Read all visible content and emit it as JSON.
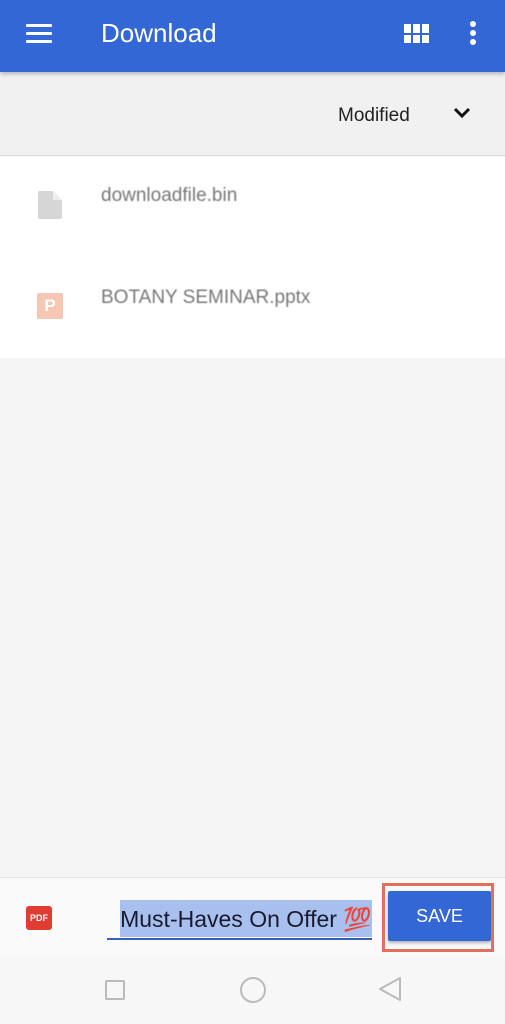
{
  "appbar": {
    "title": "Download",
    "menu_icon": "hamburger-menu-icon",
    "grid_icon": "grid-view-icon",
    "more_icon": "more-vert-icon",
    "color": "#3367d6"
  },
  "sort": {
    "label": "Modified",
    "icon": "chevron-down-icon"
  },
  "files": [
    {
      "name": "downloadfile.bin",
      "icon": "generic-file-icon"
    },
    {
      "name": "BOTANY SEMINAR.pptx",
      "icon": "powerpoint-file-icon",
      "icon_letter": "P"
    }
  ],
  "save_bar": {
    "file_type_label": "PDF",
    "filename_value": "Must-Haves On Offer 💯",
    "save_label": "SAVE"
  },
  "navbar": {
    "recents_icon": "square-icon",
    "home_icon": "circle-icon",
    "back_icon": "back-triangle-icon"
  }
}
